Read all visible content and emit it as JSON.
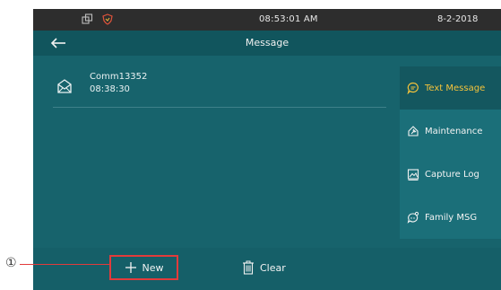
{
  "status_bar": {
    "time": "08:53:01   AM",
    "date": "8-2-2018",
    "icons": [
      "dual-window-icon",
      "shield-icon"
    ]
  },
  "header": {
    "title": "Message",
    "back_icon": "arrow-left-icon"
  },
  "messages": [
    {
      "sender": "Comm13352",
      "time": "08:38:30",
      "icon": "envelope-icon"
    }
  ],
  "side_menu": [
    {
      "label": "Text Message",
      "icon": "chat-bubble-icon",
      "active": true
    },
    {
      "label": "Maintenance",
      "icon": "wrench-icon",
      "active": false
    },
    {
      "label": "Capture Log",
      "icon": "image-log-icon",
      "active": false
    },
    {
      "label": "Family MSG",
      "icon": "family-chat-icon",
      "active": false
    }
  ],
  "actions": {
    "new_label": "New",
    "clear_label": "Clear"
  },
  "annotation": {
    "marker": "①"
  },
  "colors": {
    "screen_background": "#17636c",
    "status_bar": "#2d2d2d",
    "active_menu_text": "#f5c33b",
    "highlight_border": "#e23b3b"
  }
}
